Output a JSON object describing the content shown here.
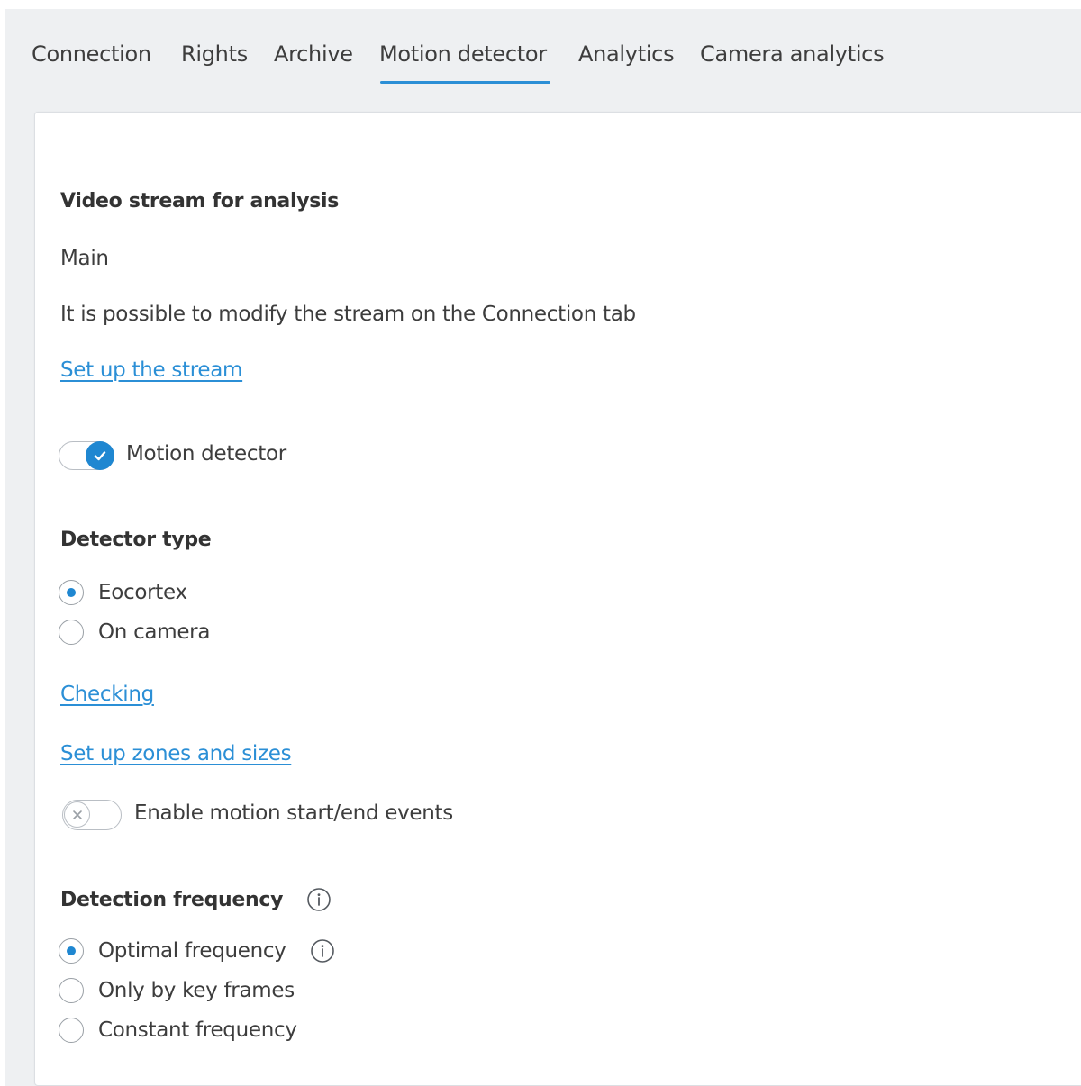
{
  "tabs": [
    {
      "label": "Connection",
      "active": false
    },
    {
      "label": "Rights",
      "active": false
    },
    {
      "label": "Archive",
      "active": false
    },
    {
      "label": "Motion detector",
      "active": true
    },
    {
      "label": "Analytics",
      "active": false
    },
    {
      "label": "Camera analytics",
      "active": false
    }
  ],
  "stream": {
    "heading": "Video stream for analysis",
    "value": "Main",
    "note": "It is possible to modify the stream on the Connection tab",
    "setup_link": "Set up the stream"
  },
  "motion_detector": {
    "label": "Motion detector",
    "enabled": true
  },
  "detector_type": {
    "heading": "Detector type",
    "options": [
      {
        "label": "Eocortex",
        "selected": true
      },
      {
        "label": "On camera",
        "selected": false
      }
    ],
    "checking_link": "Checking",
    "zones_link": "Set up zones and sizes"
  },
  "motion_events": {
    "label": "Enable motion start/end events",
    "enabled": false
  },
  "detection_frequency": {
    "heading": "Detection frequency",
    "options": [
      {
        "label": "Optimal frequency",
        "selected": true
      },
      {
        "label": "Only by key frames",
        "selected": false
      },
      {
        "label": "Constant frequency",
        "selected": false
      }
    ]
  },
  "colors": {
    "accent": "#1f87d1",
    "link": "#2b8fd6",
    "background": "#eef0f2",
    "card": "#ffffff",
    "text": "#3d3d3d"
  },
  "icons": {
    "info": "info-circle-icon",
    "check": "checkmark-icon",
    "close": "x-icon"
  }
}
